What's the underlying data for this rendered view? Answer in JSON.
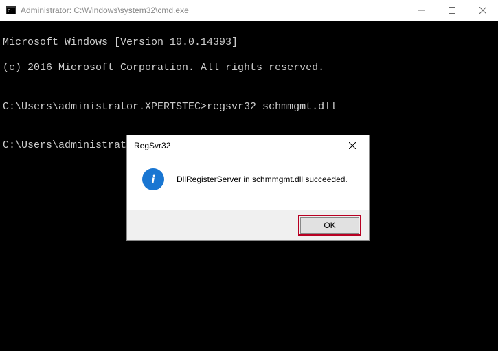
{
  "window": {
    "title": "Administrator: C:\\Windows\\system32\\cmd.exe"
  },
  "terminal": {
    "line1": "Microsoft Windows [Version 10.0.14393]",
    "line2": "(c) 2016 Microsoft Corporation. All rights reserved.",
    "blank1": "",
    "line3": "C:\\Users\\administrator.XPERTSTEC>regsvr32 schmmgmt.dll",
    "blank2": "",
    "line4": "C:\\Users\\administrator.XPERTSTEC>"
  },
  "dialog": {
    "title": "RegSvr32",
    "message": "DllRegisterServer in schmmgmt.dll succeeded.",
    "ok_label": "OK"
  }
}
